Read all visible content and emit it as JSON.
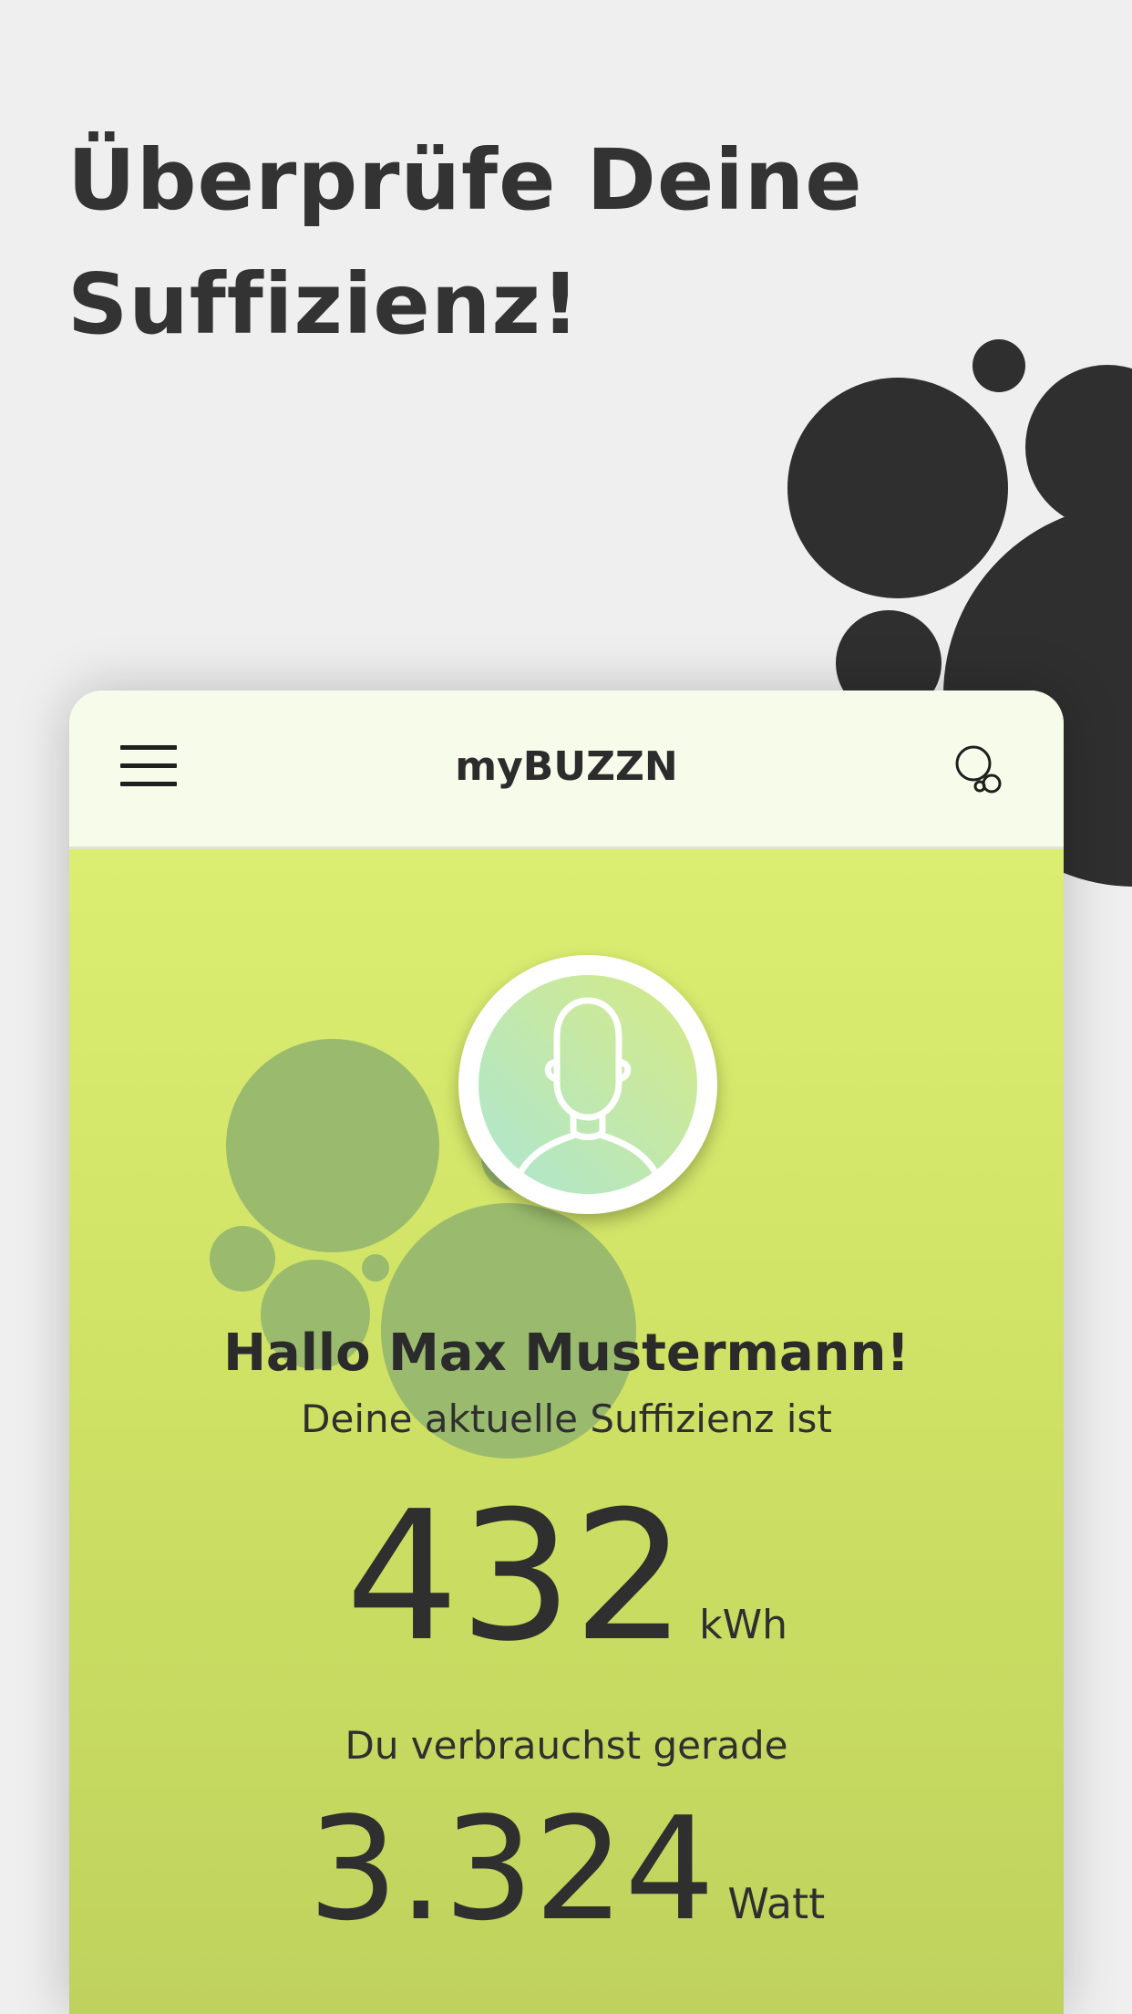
{
  "headline": {
    "line1": "Überprüfe Deine",
    "line2": "Suffizienz!"
  },
  "app": {
    "title": "myBUZZN",
    "menu_icon": "hamburger-menu-icon",
    "action_icon": "bubbles-icon"
  },
  "profile": {
    "avatar_icon": "user-avatar-icon",
    "greeting": "Hallo Max Mustermann!",
    "sufficiency_label": "Deine aktuelle Suffizienz ist",
    "sufficiency_value": "432",
    "sufficiency_unit": "kWh",
    "consumption_label": "Du verbrauchst gerade",
    "consumption_value": "3.324",
    "consumption_unit": "Watt"
  },
  "colors": {
    "background": "#efefef",
    "dark_bubbles": "#2f2f2f",
    "appbar": "#f7fbe9",
    "content_top": "#dcee72",
    "content_bottom": "#bfd25d",
    "green_bubbles": "#97b86e"
  }
}
